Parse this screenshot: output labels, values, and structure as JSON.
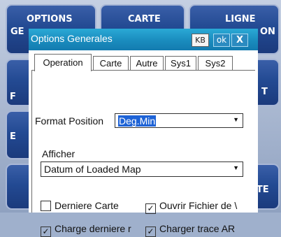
{
  "background_menu": {
    "tiles": [
      "OPTIONS GENERALES",
      "CARTE",
      "LIGNE PROJECTION",
      "F",
      "T",
      "E",
      "ITE"
    ],
    "visible_fragments": {
      "t1_line1": "OPTIONS",
      "t1_line2": "GE",
      "t2_line1": "CARTE",
      "t3_line1": "LIGNE",
      "t3_line2": "ON",
      "left_f": "F",
      "right_t": "T",
      "left_e": "E",
      "right_ite": "ITE"
    }
  },
  "dialog": {
    "title": "Options Generales",
    "buttons": {
      "kb": "KB",
      "ok": "ok",
      "close": "X"
    },
    "tabs": [
      "Operation",
      "Carte",
      "Autre",
      "Sys1",
      "Sys2"
    ],
    "active_tab": "Operation",
    "format_position": {
      "label": "Format Position",
      "value": "Deg.Min",
      "selected": true
    },
    "afficher": {
      "label": "Afficher",
      "value": "Datum of Loaded Map"
    },
    "checkboxes": [
      {
        "label": "Derniere Carte",
        "checked": false
      },
      {
        "label": "Ouvrir Fichier de \\",
        "checked": true
      },
      {
        "label": "Charge derniere r",
        "checked": true
      },
      {
        "label": "Charger trace AR",
        "checked": true
      }
    ]
  },
  "colors": {
    "titlebar": "#1a8cbe",
    "tile": "#234a93",
    "selection": "#1e63d6"
  },
  "icons": {
    "dropdown": "chevron-down-icon",
    "close": "close-icon",
    "check": "check-icon"
  }
}
